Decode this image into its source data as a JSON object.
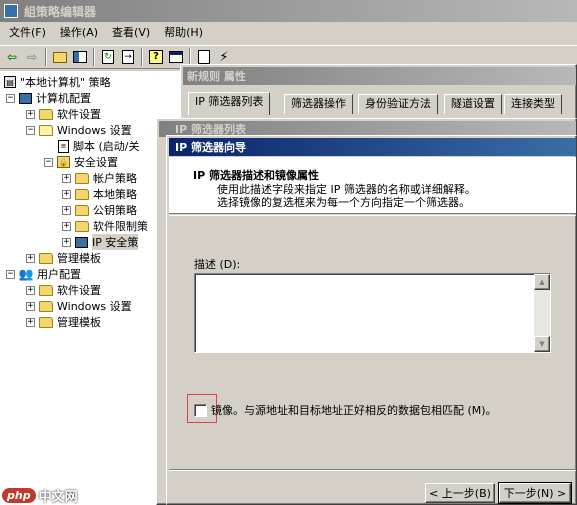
{
  "app": {
    "title": "組策略编辑器"
  },
  "menu": [
    "文件(F)",
    "操作(A)",
    "查看(V)",
    "帮助(H)"
  ],
  "toolbar": {
    "icons": [
      "back-icon",
      "forward-icon",
      "up-folder-icon",
      "show-tree-icon",
      "refresh-icon",
      "export-icon",
      "help-icon",
      "properties-icon",
      "new-icon",
      "ip-rule-icon"
    ]
  },
  "tree": {
    "root": "\"本地计算机\" 策略",
    "computer": "计算机配置",
    "computer_software": "软件设置",
    "computer_windows": "Windows 设置",
    "scripts": "脚本 (启动/关",
    "security": "安全设置",
    "account": "帐户策略",
    "local": "本地策略",
    "pubkey": "公钥策略",
    "restrict": "软件限制策",
    "ipsec": "IP 安全策",
    "computer_admin": "管理模板",
    "user": "用户配置",
    "user_software": "软件设置",
    "user_windows": "Windows 设置",
    "user_admin": "管理模板"
  },
  "props_dialog": {
    "title": "新规则 属性",
    "tabs": [
      "IP 筛选器列表",
      "筛选器操作",
      "身份验证方法",
      "隧道设置",
      "连接类型"
    ]
  },
  "filter_list_dialog": {
    "title": "IP 筛选器列表"
  },
  "wizard": {
    "title": "IP 筛选器向导",
    "heading": "IP 筛选器描述和镜像属性",
    "desc_line1": "使用此描述字段来指定 IP 筛选器的名称或详细解释。",
    "desc_line2": "选择镜像的复选框来为每一个方向指定一个筛选器。",
    "description_label": "描述 (D):",
    "description_value": "",
    "mirror_label": "镜像。与源地址和目标地址正好相反的数据包相匹配 (M)。",
    "mirror_checked": false,
    "back_label": "< 上一步(B)",
    "next_label": "下一步(N) >"
  },
  "watermark": {
    "logo": "php",
    "text": "中文网"
  },
  "colors": {
    "highlight_box": "#e04040",
    "title_blue": "#0a246a"
  }
}
